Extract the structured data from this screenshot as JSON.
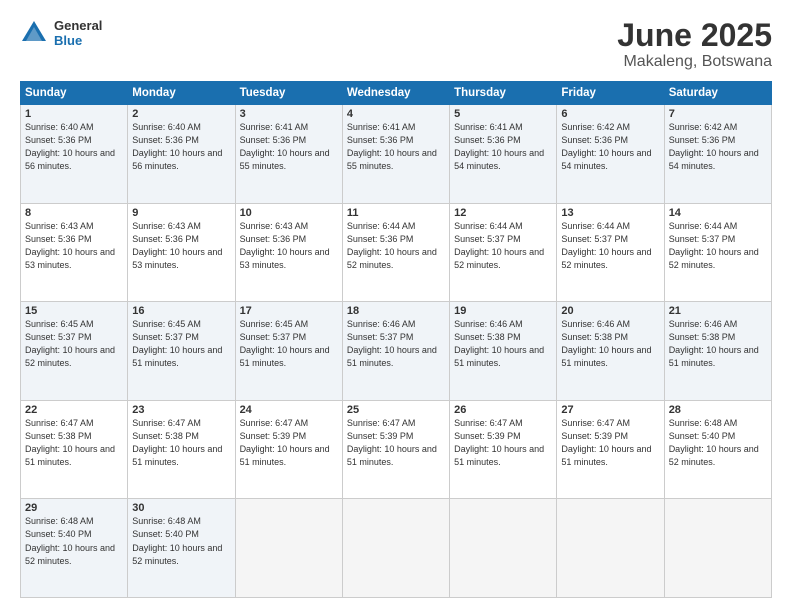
{
  "header": {
    "logo_general": "General",
    "logo_blue": "Blue",
    "title": "June 2025",
    "subtitle": "Makaleng, Botswana"
  },
  "days_of_week": [
    "Sunday",
    "Monday",
    "Tuesday",
    "Wednesday",
    "Thursday",
    "Friday",
    "Saturday"
  ],
  "weeks": [
    [
      {
        "day": "1",
        "rise": "6:40 AM",
        "set": "5:36 PM",
        "hours": "10 hours and 56 minutes."
      },
      {
        "day": "2",
        "rise": "6:40 AM",
        "set": "5:36 PM",
        "hours": "10 hours and 56 minutes."
      },
      {
        "day": "3",
        "rise": "6:41 AM",
        "set": "5:36 PM",
        "hours": "10 hours and 55 minutes."
      },
      {
        "day": "4",
        "rise": "6:41 AM",
        "set": "5:36 PM",
        "hours": "10 hours and 55 minutes."
      },
      {
        "day": "5",
        "rise": "6:41 AM",
        "set": "5:36 PM",
        "hours": "10 hours and 54 minutes."
      },
      {
        "day": "6",
        "rise": "6:42 AM",
        "set": "5:36 PM",
        "hours": "10 hours and 54 minutes."
      },
      {
        "day": "7",
        "rise": "6:42 AM",
        "set": "5:36 PM",
        "hours": "10 hours and 54 minutes."
      }
    ],
    [
      {
        "day": "8",
        "rise": "6:43 AM",
        "set": "5:36 PM",
        "hours": "10 hours and 53 minutes."
      },
      {
        "day": "9",
        "rise": "6:43 AM",
        "set": "5:36 PM",
        "hours": "10 hours and 53 minutes."
      },
      {
        "day": "10",
        "rise": "6:43 AM",
        "set": "5:36 PM",
        "hours": "10 hours and 53 minutes."
      },
      {
        "day": "11",
        "rise": "6:44 AM",
        "set": "5:36 PM",
        "hours": "10 hours and 52 minutes."
      },
      {
        "day": "12",
        "rise": "6:44 AM",
        "set": "5:37 PM",
        "hours": "10 hours and 52 minutes."
      },
      {
        "day": "13",
        "rise": "6:44 AM",
        "set": "5:37 PM",
        "hours": "10 hours and 52 minutes."
      },
      {
        "day": "14",
        "rise": "6:44 AM",
        "set": "5:37 PM",
        "hours": "10 hours and 52 minutes."
      }
    ],
    [
      {
        "day": "15",
        "rise": "6:45 AM",
        "set": "5:37 PM",
        "hours": "10 hours and 52 minutes."
      },
      {
        "day": "16",
        "rise": "6:45 AM",
        "set": "5:37 PM",
        "hours": "10 hours and 51 minutes."
      },
      {
        "day": "17",
        "rise": "6:45 AM",
        "set": "5:37 PM",
        "hours": "10 hours and 51 minutes."
      },
      {
        "day": "18",
        "rise": "6:46 AM",
        "set": "5:37 PM",
        "hours": "10 hours and 51 minutes."
      },
      {
        "day": "19",
        "rise": "6:46 AM",
        "set": "5:38 PM",
        "hours": "10 hours and 51 minutes."
      },
      {
        "day": "20",
        "rise": "6:46 AM",
        "set": "5:38 PM",
        "hours": "10 hours and 51 minutes."
      },
      {
        "day": "21",
        "rise": "6:46 AM",
        "set": "5:38 PM",
        "hours": "10 hours and 51 minutes."
      }
    ],
    [
      {
        "day": "22",
        "rise": "6:47 AM",
        "set": "5:38 PM",
        "hours": "10 hours and 51 minutes."
      },
      {
        "day": "23",
        "rise": "6:47 AM",
        "set": "5:38 PM",
        "hours": "10 hours and 51 minutes."
      },
      {
        "day": "24",
        "rise": "6:47 AM",
        "set": "5:39 PM",
        "hours": "10 hours and 51 minutes."
      },
      {
        "day": "25",
        "rise": "6:47 AM",
        "set": "5:39 PM",
        "hours": "10 hours and 51 minutes."
      },
      {
        "day": "26",
        "rise": "6:47 AM",
        "set": "5:39 PM",
        "hours": "10 hours and 51 minutes."
      },
      {
        "day": "27",
        "rise": "6:47 AM",
        "set": "5:39 PM",
        "hours": "10 hours and 51 minutes."
      },
      {
        "day": "28",
        "rise": "6:48 AM",
        "set": "5:40 PM",
        "hours": "10 hours and 52 minutes."
      }
    ],
    [
      {
        "day": "29",
        "rise": "6:48 AM",
        "set": "5:40 PM",
        "hours": "10 hours and 52 minutes."
      },
      {
        "day": "30",
        "rise": "6:48 AM",
        "set": "5:40 PM",
        "hours": "10 hours and 52 minutes."
      },
      null,
      null,
      null,
      null,
      null
    ]
  ]
}
